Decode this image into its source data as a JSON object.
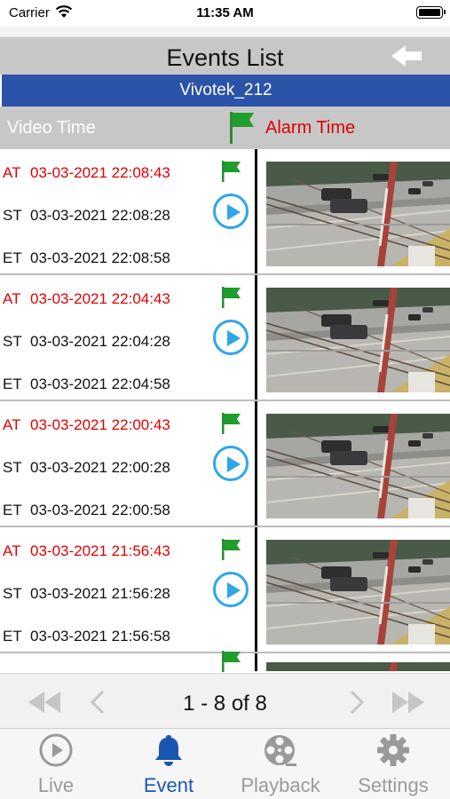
{
  "status_bar": {
    "carrier": "Carrier",
    "time": "11:35 AM"
  },
  "header": {
    "title": "Events List",
    "back_icon": "arrow-left-icon"
  },
  "device": {
    "name": "Vivotek_212"
  },
  "columns": {
    "video_time": "Video Time",
    "alarm_time": "Alarm Time"
  },
  "colors": {
    "accent_blue": "#2b53a8",
    "alarm_red": "#e00000",
    "play_blue": "#2fa6e8",
    "flag_green": "#1f9e2e",
    "active_tab": "#1a56b0"
  },
  "events": [
    {
      "at_label": "AT",
      "at": "03-03-2021 22:08:43",
      "st_label": "ST",
      "st": "03-03-2021 22:08:28",
      "et_label": "ET",
      "et": "03-03-2021 22:08:58"
    },
    {
      "at_label": "AT",
      "at": "03-03-2021 22:04:43",
      "st_label": "ST",
      "st": "03-03-2021 22:04:28",
      "et_label": "ET",
      "et": "03-03-2021 22:04:58"
    },
    {
      "at_label": "AT",
      "at": "03-03-2021 22:00:43",
      "st_label": "ST",
      "st": "03-03-2021 22:00:28",
      "et_label": "ET",
      "et": "03-03-2021 22:00:58"
    },
    {
      "at_label": "AT",
      "at": "03-03-2021 21:56:43",
      "st_label": "ST",
      "st": "03-03-2021 21:56:28",
      "et_label": "ET",
      "et": "03-03-2021 21:56:58"
    }
  ],
  "pagination": {
    "text": "1 - 8 of 8"
  },
  "tabs": [
    {
      "label": "Live",
      "icon": "play-circle-icon",
      "active": false
    },
    {
      "label": "Event",
      "icon": "bell-icon",
      "active": true
    },
    {
      "label": "Playback",
      "icon": "film-reel-icon",
      "active": false
    },
    {
      "label": "Settings",
      "icon": "gear-icon",
      "active": false
    }
  ]
}
